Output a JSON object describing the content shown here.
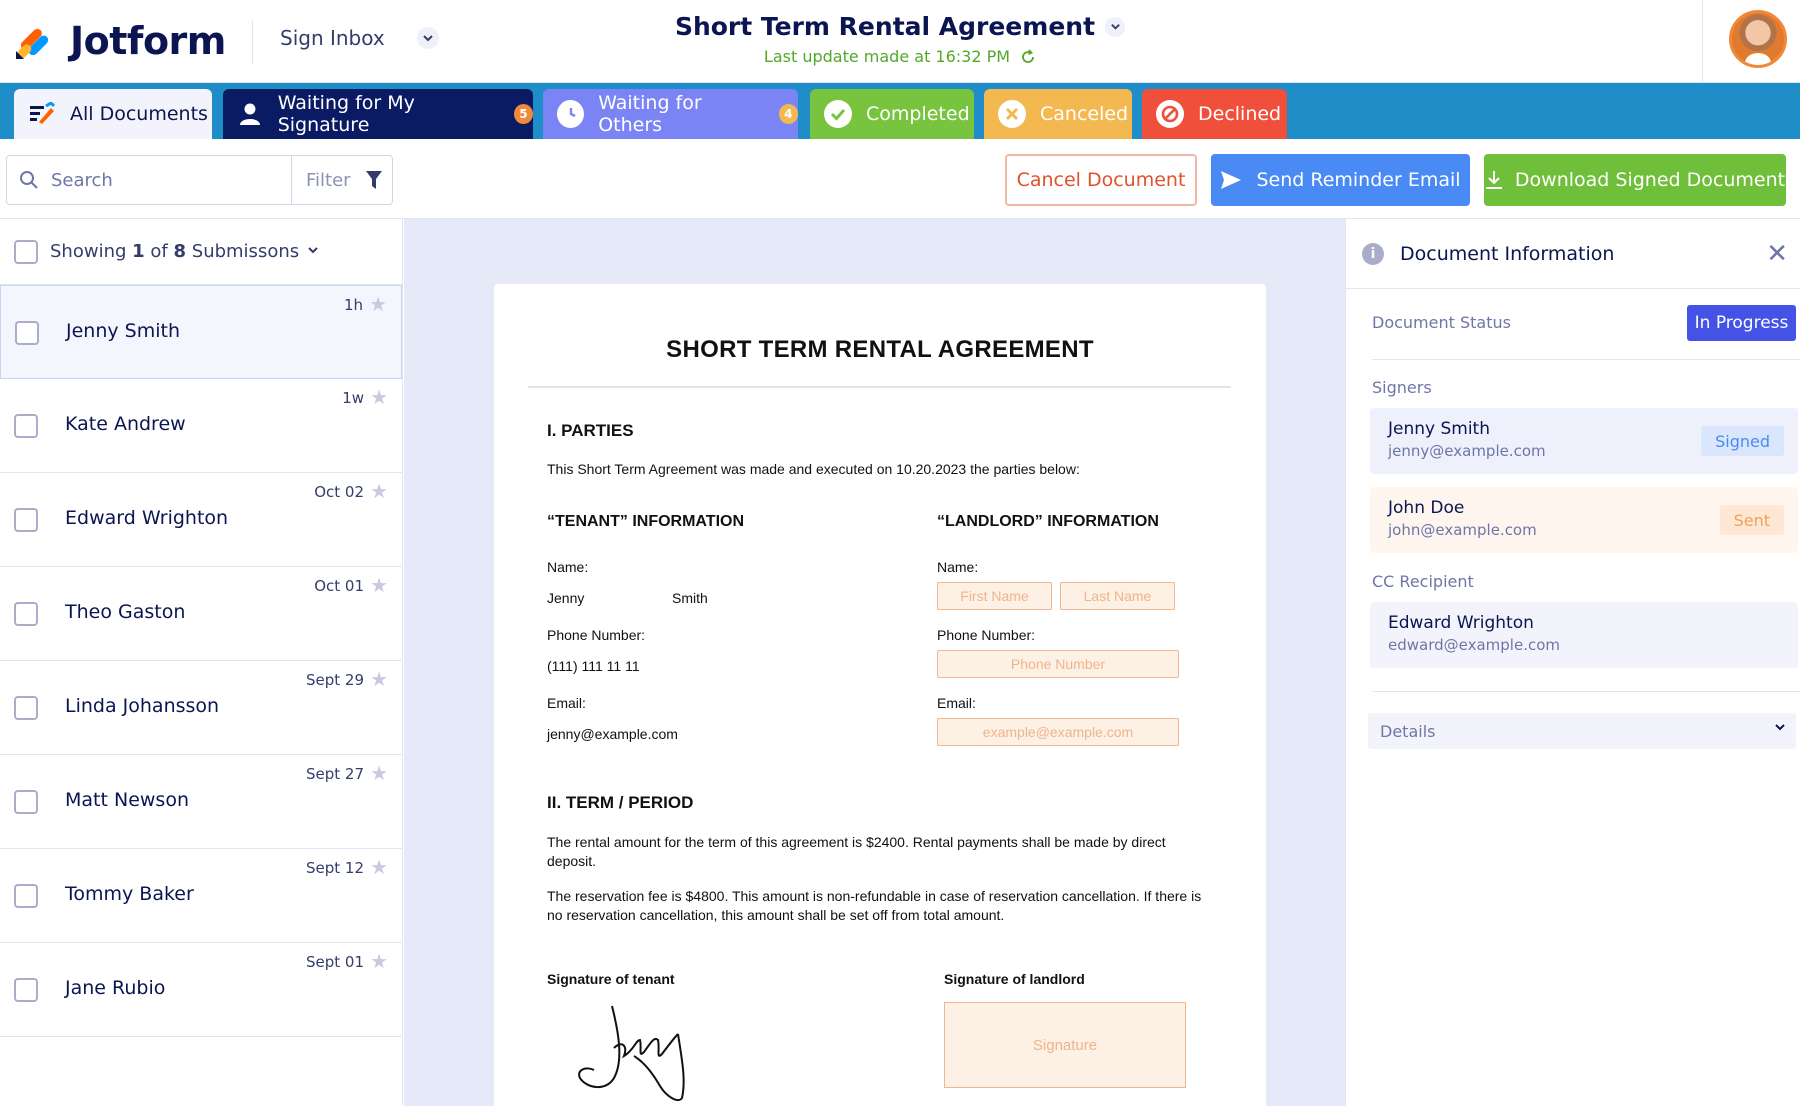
{
  "header": {
    "brand": "Jotform",
    "app_name": "Sign Inbox",
    "doc_title": "Short Term Rental Agreement",
    "last_update": "Last update made at 16:32 PM"
  },
  "tabs": [
    {
      "label": "All Documents",
      "count": ""
    },
    {
      "label": "Waiting for My Signature",
      "count": "5"
    },
    {
      "label": "Waiting for Others",
      "count": "4"
    },
    {
      "label": "Completed",
      "count": ""
    },
    {
      "label": "Canceled",
      "count": ""
    },
    {
      "label": "Declined",
      "count": ""
    }
  ],
  "toolbar": {
    "search_placeholder": "Search",
    "filter_label": "Filter",
    "cancel_label": "Cancel Document",
    "remind_label": "Send Reminder Email",
    "download_label": "Download Signed Document"
  },
  "list": {
    "showing_prefix": "Showing",
    "showing_current": "1",
    "showing_of": "of",
    "showing_total": "8",
    "showing_suffix": "Submissons",
    "items": [
      {
        "name": "Jenny Smith",
        "time": "1h"
      },
      {
        "name": "Kate Andrew",
        "time": "1w"
      },
      {
        "name": "Edward Wrighton",
        "time": "Oct 02"
      },
      {
        "name": "Theo Gaston",
        "time": "Oct 01"
      },
      {
        "name": "Linda Johansson",
        "time": "Sept 29"
      },
      {
        "name": "Matt Newson",
        "time": "Sept 27"
      },
      {
        "name": "Tommy Baker",
        "time": "Sept 12"
      },
      {
        "name": "Jane Rubio",
        "time": "Sept 01"
      }
    ]
  },
  "document": {
    "title": "SHORT TERM RENTAL AGREEMENT",
    "section1": "I. PARTIES",
    "intro": "This Short Term Agreement was made and executed on 10.20.2023 the parties below:",
    "tenant_heading": "“TENANT” INFORMATION",
    "landlord_heading": "“LANDLORD” INFORMATION",
    "name_label": "Name:",
    "phone_label": "Phone Number:",
    "email_label": "Email:",
    "tenant_first": "Jenny",
    "tenant_last": "Smith",
    "tenant_phone": "(111) 111 11 11",
    "tenant_email": "jenny@example.com",
    "ph_first": "First Name",
    "ph_last": "Last Name",
    "ph_phone": "Phone Number",
    "ph_email": "example@example.com",
    "section2": "II. TERM / PERIOD",
    "para1": "The rental amount for the term of this agreement is $2400. Rental payments shall be made by direct deposit.",
    "para2": "The reservation fee is $4800. This amount is non-refundable in case of reservation cancellation. If there is no reservation cancellation, this amount shall be set off from total amount.",
    "sig_tenant_label": "Signature of tenant",
    "sig_landlord_label": "Signature of landlord",
    "sig_placeholder": "Signature"
  },
  "info_panel": {
    "title": "Document Information",
    "status_label": "Document Status",
    "status_value": "In Progress",
    "signers_label": "Signers",
    "signers": [
      {
        "name": "Jenny Smith",
        "email": "jenny@example.com",
        "state": "Signed"
      },
      {
        "name": "John Doe",
        "email": "john@example.com",
        "state": "Sent"
      }
    ],
    "cc_label": "CC Recipient",
    "cc": {
      "name": "Edward Wrighton",
      "email": "edward@example.com"
    },
    "details_label": "Details"
  },
  "colors": {
    "tab_bar": "#1f8dc8",
    "waiting_me": "#0a1b63",
    "waiting_others": "#7b84f5",
    "completed": "#78c43f",
    "canceled": "#f4b850",
    "declined": "#f0503b",
    "primary_blue": "#4a8af4",
    "download_green": "#6fbf3a",
    "status_pill": "#4453e6"
  }
}
